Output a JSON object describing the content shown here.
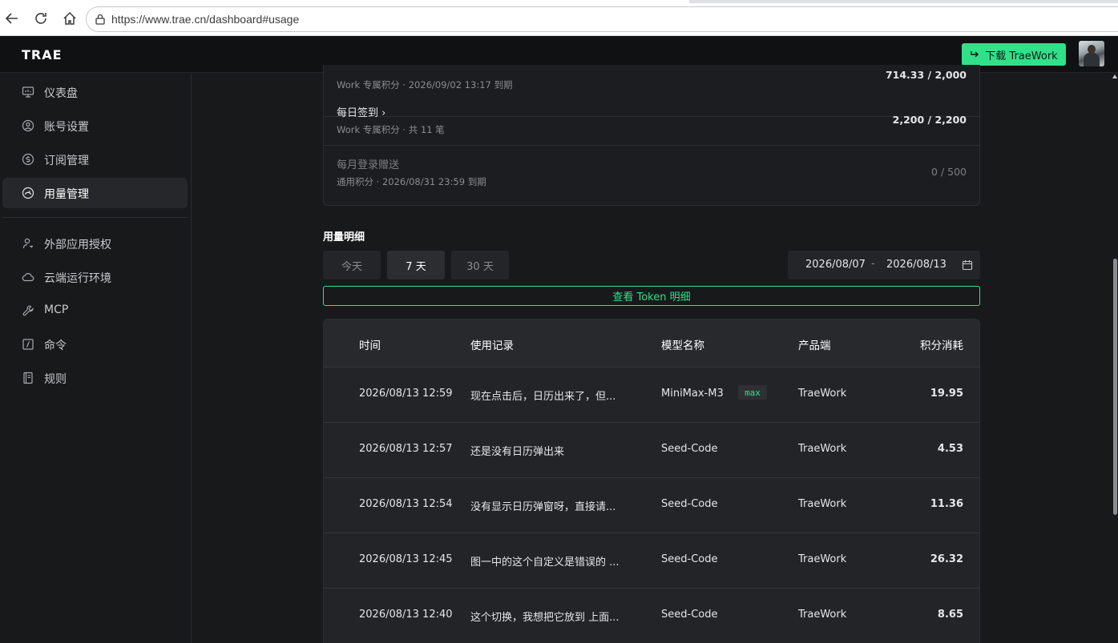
{
  "browser": {
    "url": "https://www.trae.cn/dashboard#usage"
  },
  "header": {
    "logo": "TRAE",
    "download_label": "下载 TraeWork"
  },
  "sidebar": {
    "items": [
      {
        "label": "仪表盘",
        "icon": "monitor-icon"
      },
      {
        "label": "账号设置",
        "icon": "user-circle-icon"
      },
      {
        "label": "订阅管理",
        "icon": "dollar-circle-icon"
      },
      {
        "label": "用量管理",
        "icon": "gauge-icon",
        "active": true
      },
      {
        "label": "外部应用授权",
        "icon": "user-key-icon"
      },
      {
        "label": "云端运行环境",
        "icon": "cloud-icon"
      },
      {
        "label": "MCP",
        "icon": "wrench-icon"
      },
      {
        "label": "命令",
        "icon": "slash-box-icon"
      },
      {
        "label": "规则",
        "icon": "book-icon"
      }
    ]
  },
  "credits": [
    {
      "title": "",
      "sub": "Work 专属积分 · 2026/09/02 13:17 到期",
      "value": "714.33 / 2,000"
    },
    {
      "title": "每日签到 ›",
      "sub": "Work 专属积分 · 共 11 笔",
      "value": "2,200 / 2,200"
    },
    {
      "title": "每月登录赠送",
      "sub": "通用积分 · 2026/08/31 23:59 到期",
      "value": "0 / 500",
      "dim": true
    }
  ],
  "usage": {
    "section_title": "用量明细",
    "ranges": [
      "今天",
      "7 天",
      "30 天"
    ],
    "active_range": "7 天",
    "date_from": "2026/08/07",
    "date_sep": "-",
    "date_to": "2026/08/13",
    "token_button": "查看 Token 明细",
    "columns": [
      "时间",
      "使用记录",
      "模型名称",
      "产品端",
      "积分消耗"
    ],
    "rows": [
      {
        "time": "2026/08/13 12:59",
        "record": "现在点击后，日历出来了，但...",
        "model": "MiniMax-M3",
        "badge": "max",
        "client": "TraeWork",
        "cost": "19.95"
      },
      {
        "time": "2026/08/13 12:57",
        "record": "还是没有日历弹出来",
        "model": "Seed-Code",
        "client": "TraeWork",
        "cost": "4.53"
      },
      {
        "time": "2026/08/13 12:54",
        "record": "没有显示日历弹窗呀，直接请...",
        "model": "Seed-Code",
        "client": "TraeWork",
        "cost": "11.36"
      },
      {
        "time": "2026/08/13 12:45",
        "record": "图一中的这个自定义是错误的 ...",
        "model": "Seed-Code",
        "client": "TraeWork",
        "cost": "26.32"
      },
      {
        "time": "2026/08/13 12:40",
        "record": "这个切换，我想把它放到 上面...",
        "model": "Seed-Code",
        "client": "TraeWork",
        "cost": "8.65"
      }
    ]
  },
  "colors": {
    "accent": "#32e08a",
    "background": "#18191b",
    "panel": "#232427"
  }
}
